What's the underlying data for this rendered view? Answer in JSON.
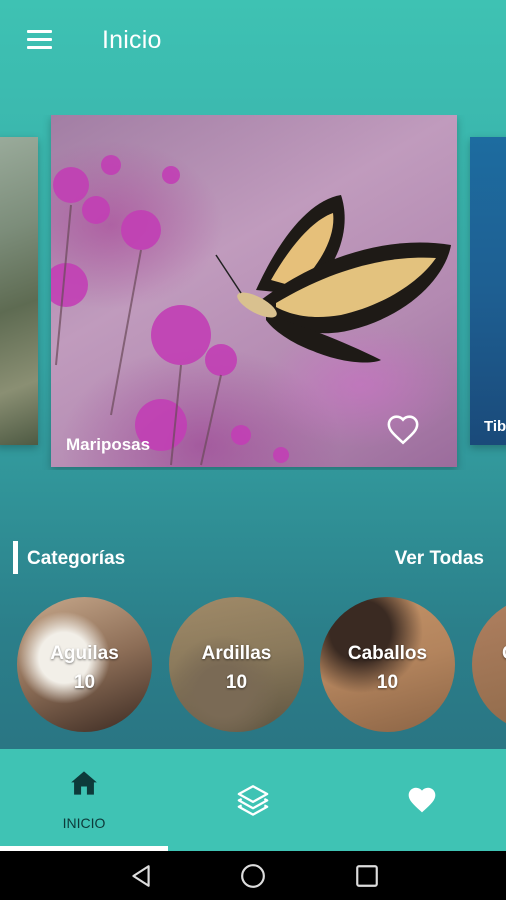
{
  "appbar": {
    "title": "Inicio",
    "menu_icon": "hamburger-menu-icon"
  },
  "carousel": {
    "cards": [
      {
        "label": ""
      },
      {
        "label": "Mariposas",
        "favorite_icon": "heart-outline-icon"
      },
      {
        "label": "Tib"
      }
    ]
  },
  "categories": {
    "title": "Categorías",
    "see_all": "Ver Todas",
    "items": [
      {
        "name": "Aguilas",
        "count": "10"
      },
      {
        "name": "Ardillas",
        "count": "10"
      },
      {
        "name": "Caballos",
        "count": "10"
      },
      {
        "name": "C",
        "count": ""
      }
    ]
  },
  "bottom_nav": {
    "items": [
      {
        "label": "INICIO",
        "icon": "home-icon",
        "active": true
      },
      {
        "label": "",
        "icon": "layers-icon",
        "active": false
      },
      {
        "label": "",
        "icon": "heart-icon",
        "active": false
      }
    ]
  },
  "colors": {
    "primary": "#3fc3b4",
    "accent": "#ffffff",
    "nav_label": "#0d3a3a"
  }
}
